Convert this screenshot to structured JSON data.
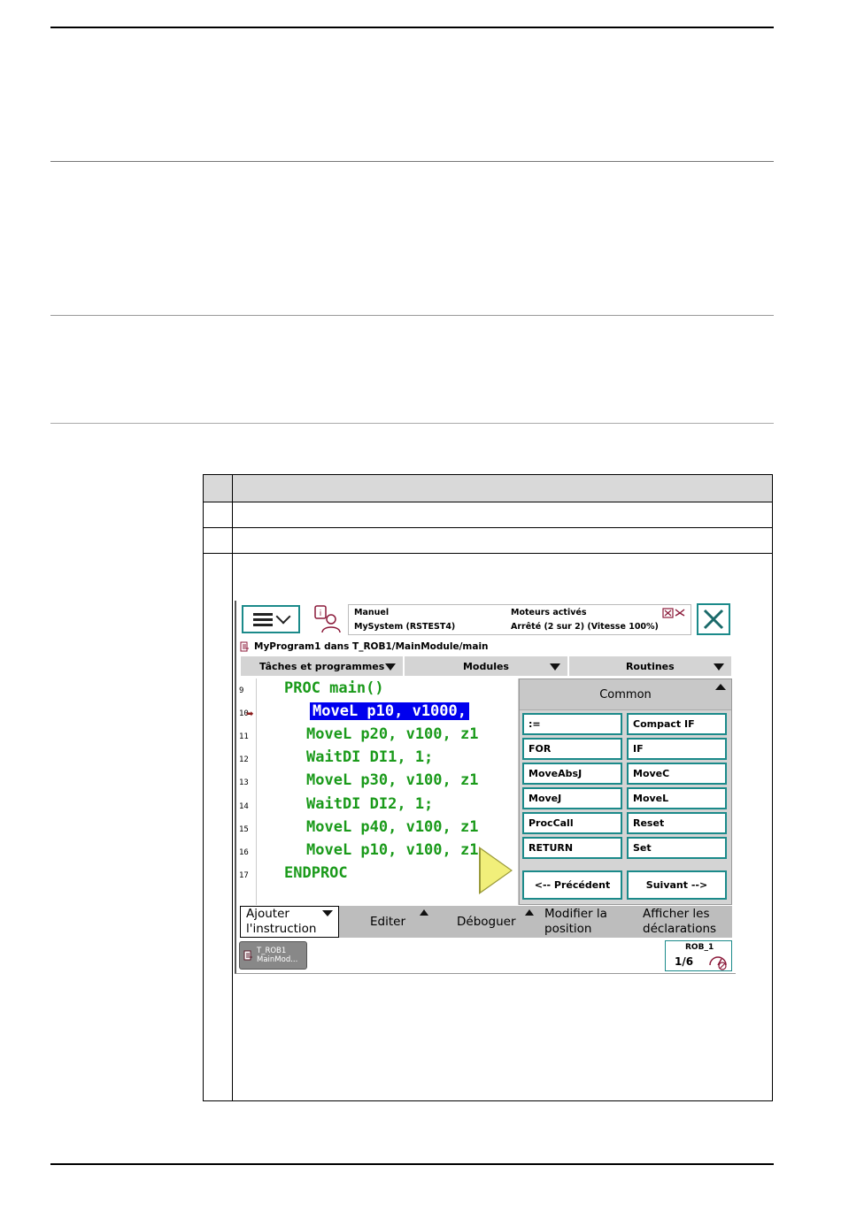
{
  "pendant": {
    "status": {
      "mode": "Manuel",
      "system": "MySystem (RSTEST4)",
      "motors": "Moteurs activés",
      "state": "Arrêté (2 sur 2) (Vitesse 100%)"
    },
    "path": "MyProgram1 dans T_ROB1/MainModule/main",
    "tabs": [
      "Tâches et programmes",
      "Modules",
      "Routines"
    ],
    "code": {
      "line_numbers": [
        "9",
        "10",
        "11",
        "12",
        "13",
        "14",
        "15",
        "16",
        "17"
      ],
      "lines": [
        "PROC main()",
        "MoveL p10, v1000,",
        "MoveL p20, v100, z1",
        "WaitDI DI1, 1;",
        "MoveL p30, v100, z1",
        "WaitDI DI2, 1;",
        "MoveL p40, v100, z1",
        "MoveL p10, v100, z1",
        "ENDPROC"
      ],
      "selected_line": "10"
    },
    "panel": {
      "title": "Common",
      "instructions": [
        ":=",
        "Compact IF",
        "FOR",
        "IF",
        "MoveAbsJ",
        "MoveC",
        "MoveJ",
        "MoveL",
        "ProcCall",
        "Reset",
        "RETURN",
        "Set"
      ],
      "prev": "<--  Précédent",
      "next": "Suivant  -->"
    },
    "bottom": {
      "add_1": "Ajouter",
      "add_2": "l'instruction",
      "edit": "Editer",
      "debug": "Déboguer",
      "modify_1": "Modifier la",
      "modify_2": "position",
      "show_1": "Afficher les",
      "show_2": "déclarations"
    },
    "task": {
      "line1": "T_ROB1",
      "line2": "MainMod..."
    },
    "robot": {
      "name": "ROB_1",
      "fraction": "1/6"
    },
    "accent_color": "#1b8a8a",
    "code_color": "#1a9a1a",
    "selection_color": "#0000ee"
  }
}
